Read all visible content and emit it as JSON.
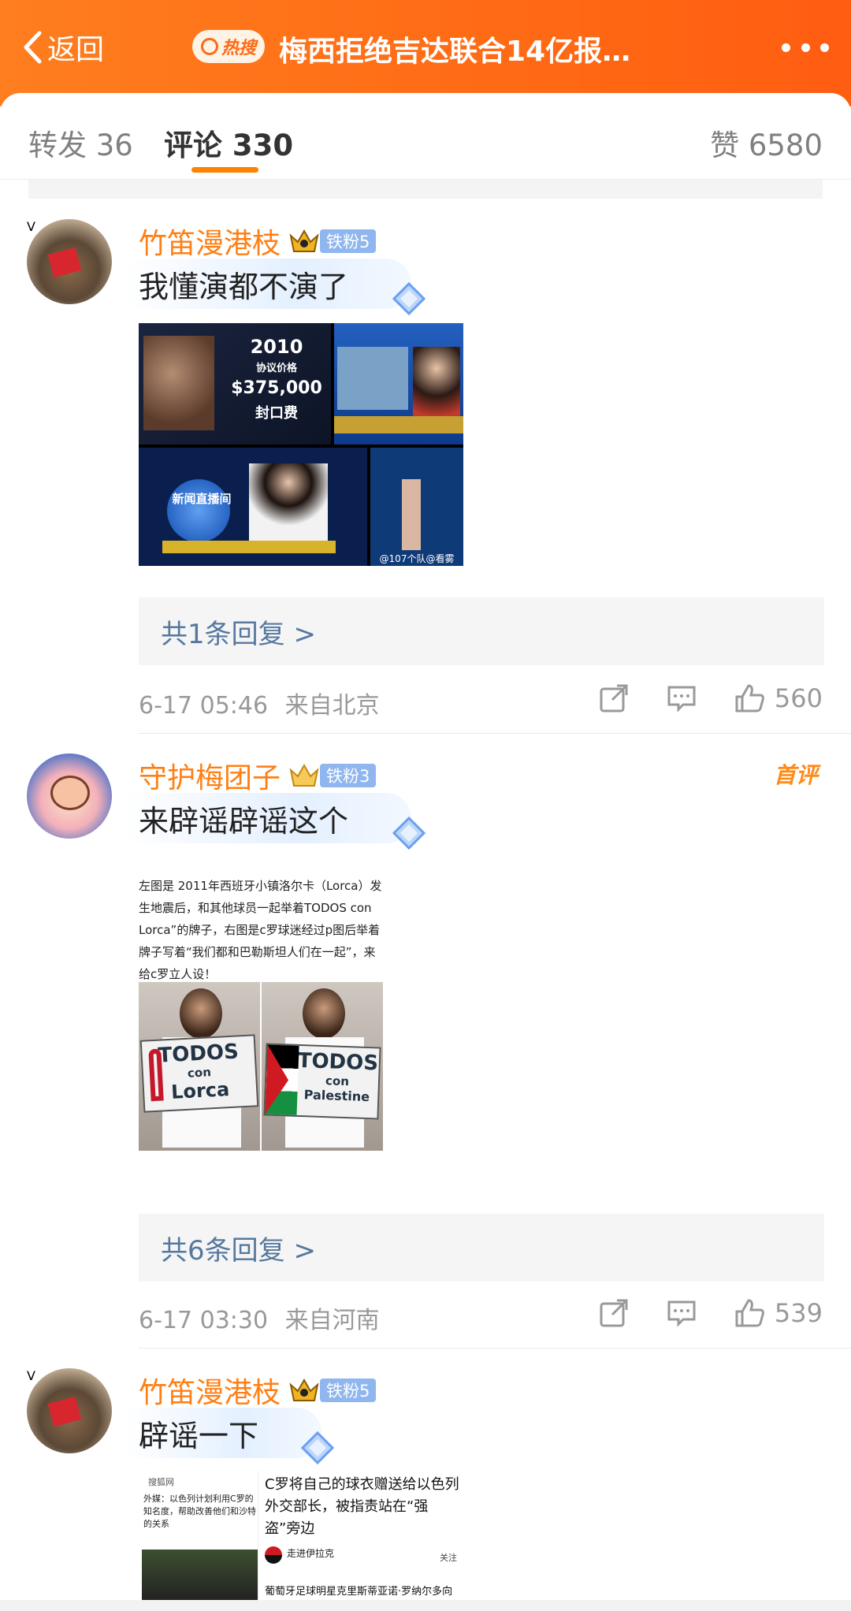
{
  "header": {
    "back_label": "返回",
    "hot_badge": "热搜",
    "title": "梅西拒绝吉达联合14亿报…"
  },
  "tabs": {
    "repost": "转发 36",
    "comments": "评论 330",
    "likes": "赞 6580"
  },
  "colors": {
    "accent": "#ff8200",
    "name": "#ff7f14",
    "link": "#56789e"
  },
  "comments": [
    {
      "user": "竹笛漫港枝",
      "fan_badge": "铁粉5",
      "text": "我懂演都不演了",
      "image_texts": {
        "year": "2010",
        "price_label": "协议价格",
        "amount": "$375,000",
        "fee": "封口费",
        "news": "新闻直播间",
        "watermark": "@107个队@看雾"
      },
      "replies": "共1条回复 >",
      "time": "6-17 05:46",
      "location": "来自北京",
      "likes": "560"
    },
    {
      "user": "守护梅团子",
      "fan_badge": "铁粉3",
      "first_tag": "首评",
      "text": "来辟谣辟谣这个",
      "image_texts": {
        "caption": "左图是 2011年西班牙小镇洛尔卡（Lorca）发生地震后，和其他球员一起举着TODOS con Lorca”的牌子，右图是c罗球迷经过p图后举着牌子写着“我们都和巴勒斯坦人们在一起”，来给c罗立人设！",
        "sign_left_1": "TODOS",
        "sign_left_2": "con",
        "sign_left_3": "Lorca",
        "sign_right_1": "TODOS",
        "sign_right_2": "con",
        "sign_right_3": "Palestine"
      },
      "replies": "共6条回复 >",
      "time": "6-17 03:30",
      "location": "来自河南",
      "likes": "539"
    },
    {
      "user": "竹笛漫港枝",
      "fan_badge": "铁粉5",
      "text": "辟谣一下",
      "image_texts": {
        "site": "搜狐网",
        "left_text": "外媒：以色列计划利用C罗的知名度，帮助改善他们和沙特的关系",
        "right_title": "C罗将自己的球衣赠送给以色列外交部长，被指责站在“强盗”旁边",
        "account": "走进伊拉克",
        "follow": "关注",
        "bottom": "葡萄牙足球明星克里斯蒂亚诺·罗纳尔多向"
      }
    }
  ]
}
